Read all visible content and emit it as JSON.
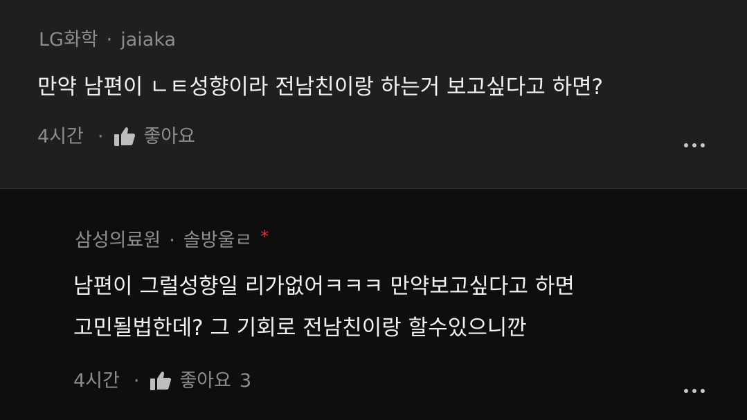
{
  "comments": [
    {
      "community": "LG화학",
      "separator": "·",
      "author": "jaiaka",
      "lines": [
        "만약 남편이 ㄴㅌ성향이라 전남친이랑 하는거 보고싶다고 하면?"
      ],
      "time": "4시간",
      "footer_separator": "·",
      "like_label": "좋아요",
      "like_count": "",
      "icons": {
        "like": "thumbs-up-icon",
        "more": "more-options-icon"
      }
    },
    {
      "community": "삼성의료원",
      "separator": "·",
      "author": "솔방울ㄹ",
      "author_mark": "*",
      "lines": [
        "남편이 그럴성향일 리가없어ㅋㅋㅋ 만약보고싶다고 하면",
        "고민될법한데? 그 기회로 전남친이랑 할수있으니깐"
      ],
      "time": "4시간",
      "footer_separator": "·",
      "like_label": "좋아요",
      "like_count": "3",
      "icons": {
        "like": "thumbs-up-icon",
        "more": "more-options-icon"
      }
    }
  ],
  "colors": {
    "background_primary": "#1f1f1f",
    "background_reply": "#0e0e0e",
    "text_primary": "#f2f2f2",
    "text_secondary": "#8d8d8d",
    "accent_star": "#d93a3a"
  }
}
